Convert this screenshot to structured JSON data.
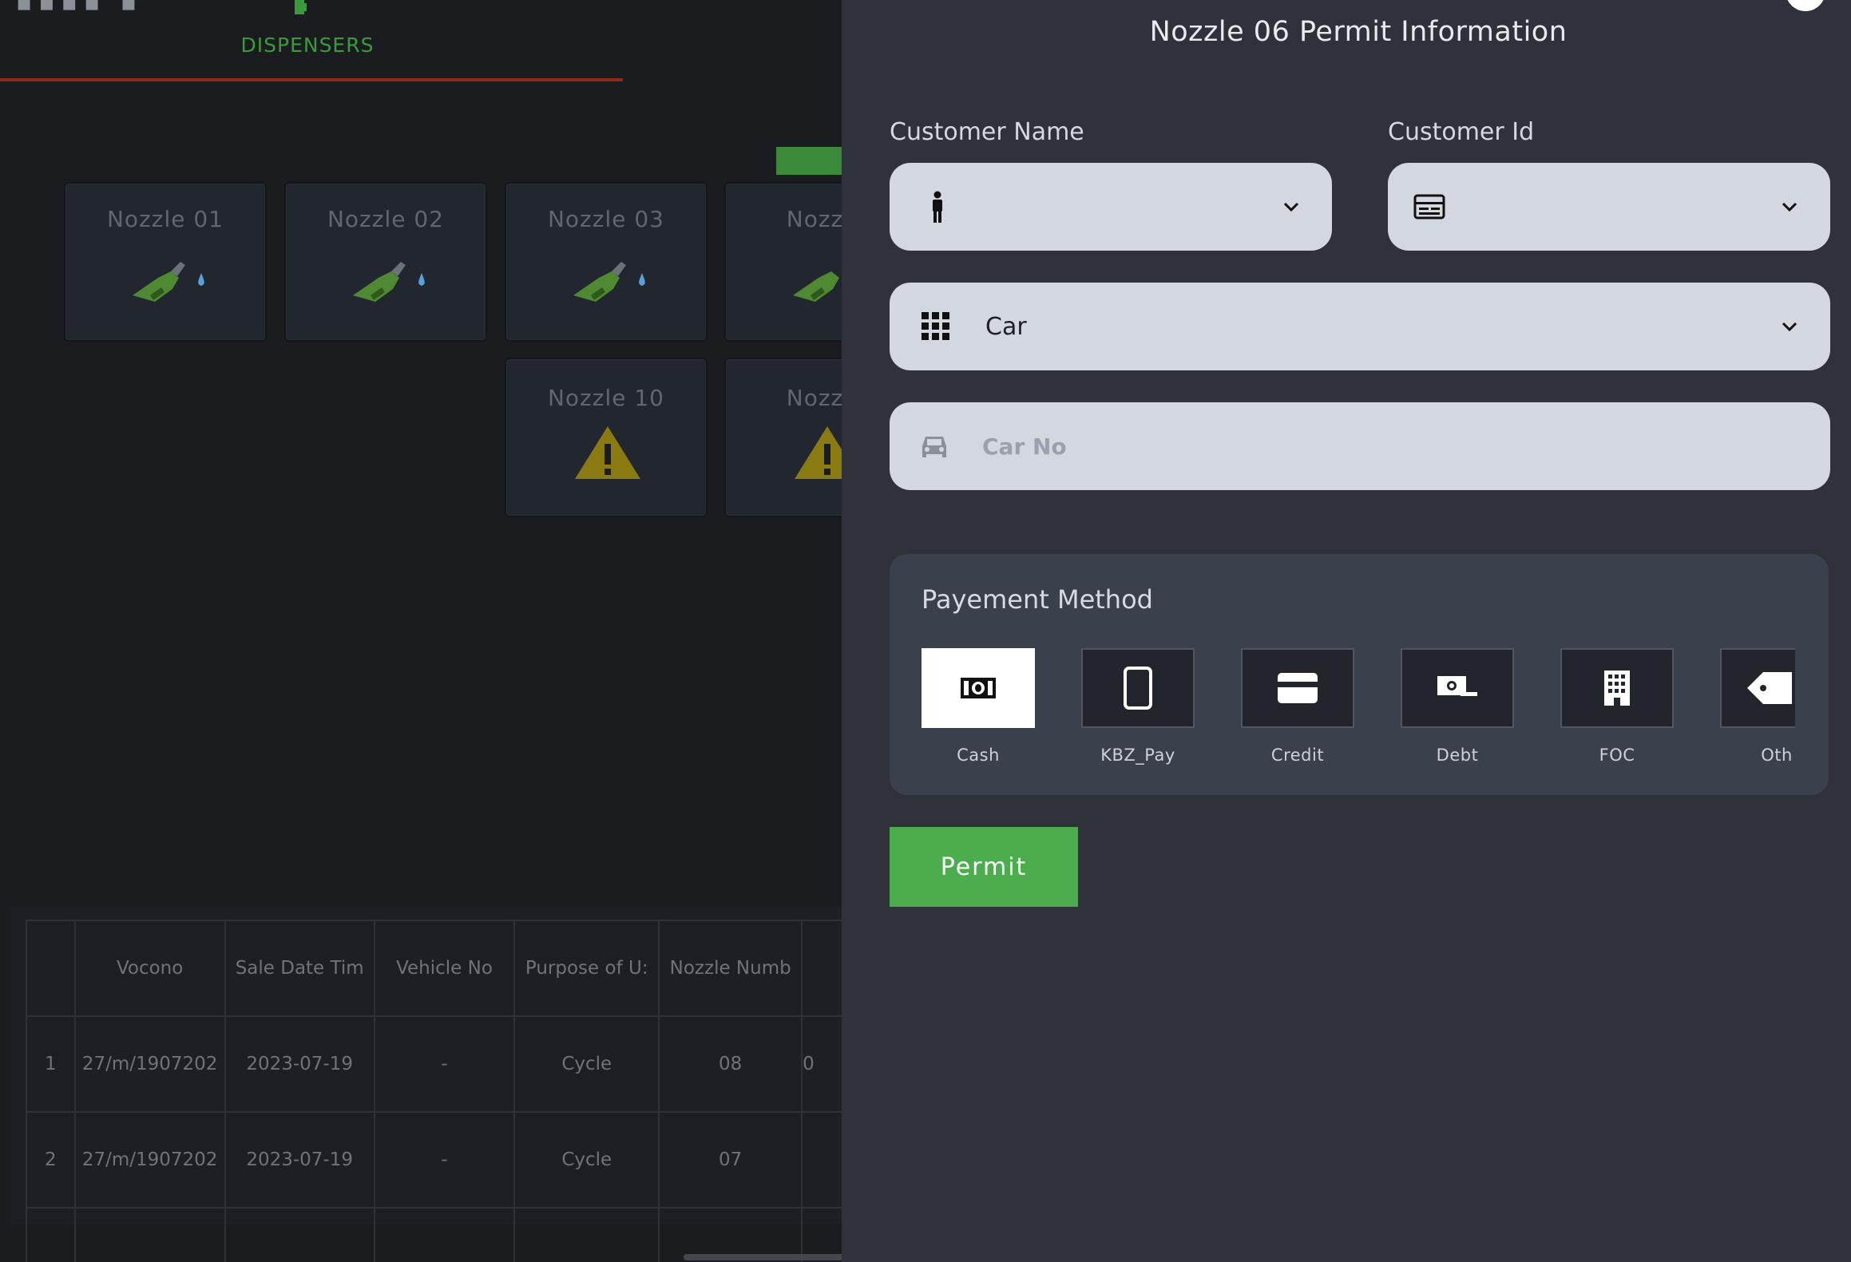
{
  "background": {
    "tab": {
      "label": "DISPENSERS"
    },
    "nozzles": [
      {
        "name": "Nozzle 01",
        "status": "idle"
      },
      {
        "name": "Nozzle 02",
        "status": "idle"
      },
      {
        "name": "Nozzle 03",
        "status": "idle"
      },
      {
        "name": "Nozzle",
        "status": "idle"
      },
      {
        "name": "Nozzle 10",
        "status": "warning"
      },
      {
        "name": "Nozzle",
        "status": "warning"
      }
    ],
    "table": {
      "headers": [
        "",
        "Vocono",
        "Sale Date Tim",
        "Vehicle No",
        "Purpose of U:",
        "Nozzle Numb",
        ""
      ],
      "rows": [
        [
          "1",
          "27/m/1907202",
          "2023-07-19",
          "-",
          "Cycle",
          "08",
          "0"
        ],
        [
          "2",
          "27/m/1907202",
          "2023-07-19",
          "-",
          "Cycle",
          "07",
          ""
        ]
      ]
    }
  },
  "drawer": {
    "title": "Nozzle 06 Permit Information",
    "customer_name": {
      "label": "Customer Name",
      "value": ""
    },
    "customer_id": {
      "label": "Customer Id",
      "value": ""
    },
    "vehicle_type": {
      "value": "Car"
    },
    "car_no": {
      "placeholder": "Car No",
      "value": ""
    },
    "payment": {
      "title": "Payement Method",
      "methods": [
        {
          "label": "Cash",
          "icon": "cash-icon",
          "selected": true
        },
        {
          "label": "KBZ_Pay",
          "icon": "phone-icon",
          "selected": false
        },
        {
          "label": "Credit",
          "icon": "credit-card-icon",
          "selected": false
        },
        {
          "label": "Debt",
          "icon": "debt-icon",
          "selected": false
        },
        {
          "label": "FOC",
          "icon": "building-icon",
          "selected": false
        },
        {
          "label": "Oth",
          "icon": "tag-icon",
          "selected": false
        }
      ]
    },
    "permit_label": "Permit"
  },
  "colors": {
    "accent_green": "#4cad4f",
    "tab_underline": "#8e2b17",
    "drawer_bg": "#2f323b",
    "field_bg": "#d3d8e0"
  }
}
